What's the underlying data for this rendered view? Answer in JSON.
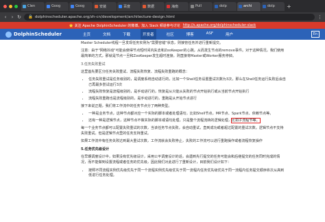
{
  "browser": {
    "tabs": [
      {
        "label": "Clen",
        "color": "#4aa3df"
      },
      {
        "label": "Goog",
        "color": "#4285f4"
      },
      {
        "label": "Goog",
        "color": "#4285f4"
      },
      {
        "label": "安装",
        "color": "#e25a33"
      },
      {
        "label": "百度",
        "color": "#3385ff"
      },
      {
        "label": "数据",
        "color": "#e25a33"
      },
      {
        "label": "海南",
        "color": "#d33"
      },
      {
        "label": "Pull",
        "color": "#888888"
      },
      {
        "label": "dolp",
        "color": "#2c63b8"
      },
      {
        "label": "archi",
        "color": "#2c63b8"
      },
      {
        "label": "dolp",
        "color": "#2c63b8"
      }
    ],
    "active_tab": 9,
    "new_tab": "+",
    "url": "dolphinscheduler.apache.org/zh-cn/development/architecture-design.html"
  },
  "banner": {
    "text": "⭐ 关注 Apache DolphinScheduler 的微博，加入 Slack 频道参与讨论",
    "link": "http://s.apache.org/dolphinscheduler-slack"
  },
  "sitenav": {
    "logo": "DolphinScheduler",
    "links": [
      "主页",
      "文档",
      "下载",
      "开发者",
      "社区",
      "博客",
      "ASF",
      "用户"
    ],
    "active": 3,
    "lang": "En"
  },
  "article": {
    "p1": "Master Scheduler线程一旦发现任务实例为\"需要容错\"状态，则接管任务并进行重新提交。",
    "p2": "注意：由于\"网络抖动\"可能会使得节点短时间内失去和ZooKeeper的心跳，从而发生节点的remove事件。对于这种情况，我们使用最简单的方式，那就是节点一旦和ZooKeeper发生超时连接，则直接将Master或Worker服务停掉。",
    "h_retry": "3.任务失败重试",
    "p3": "这里首先要区分任务失败重试、流程失败恢复、流程失败重跑的概念：",
    "list1": [
      {
        "text": "任务失败重试是任务级别的，是调度系统自动进行的，比如一个Shell任务设置重试次数为3次，那么在Shell任务运行失败后会自己再最多尝试运行3次"
      },
      {
        "text": "流程失败恢复是流程级别的，是手动进行的，恢复是从只能从失败的节点开始执行或从当前节点开始执行"
      },
      {
        "text": "流程失败重跑也是流程级别的，是手动进行的，重跑是从开始节点进行"
      }
    ],
    "p4": "接下来说正题，我们将工作流中的任务节点分了两种类型。",
    "list2": [
      {
        "text": "一种是业务节点，这种节点都对应一个实际的脚本或者处理语句，比如Shell节点，MR节点、Spark节点、依赖节点等。"
      },
      {
        "text_a": "还有一种是逻辑节点，这种节点不做实际的脚本或语句处理，只是整个流程流转的逻辑处理，",
        "text_b": "比如子流程节等。"
      }
    ],
    "p5": "每一个业务节点都可以配置失败重试的次数，当该任务节点失败，会自动重试，直到成功或者超过配置的重试次数。逻辑节点不支持失败重试。但是逻辑节点里的任务支持重试。",
    "p6": "如果工作流中有任务失败达到最大重试次数，工作流就会失败停止，失败的工作流可以进行重跑操作或者流程恢复操作",
    "h_priority": "5.任务优先级设计",
    "p7": "在早期调度设计中，如果没有优先级设计，采用公平调度设计的话，会遇到先行提交的任务可能会和后继提交的任务同时完成的情况，而不能做到设置流程或者任务的优先级，因此我们对此进行了重新设计，目前我们设计如下：",
    "list3": [
      {
        "text": "按照不同流程实例优先级优先于同一个流程实例优先级优先于同一流程内任务优先级优先于同一流程内任务提交顺序依次从高到低进行任务处理。"
      }
    ]
  }
}
